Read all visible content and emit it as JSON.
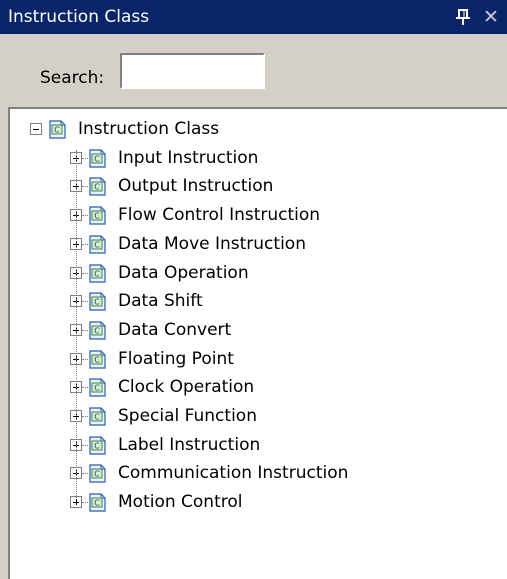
{
  "panel": {
    "title": "Instruction Class",
    "pin_icon": "pin-icon",
    "close_icon": "close-icon"
  },
  "search": {
    "label": "Search:",
    "value": "",
    "placeholder": ""
  },
  "tree": {
    "root": {
      "label": "Instruction Class",
      "expanded": true,
      "icon": "class-icon"
    },
    "children": [
      {
        "label": "Input Instruction",
        "expanded": false
      },
      {
        "label": "Output Instruction",
        "expanded": false
      },
      {
        "label": "Flow Control Instruction",
        "expanded": false
      },
      {
        "label": "Data Move Instruction",
        "expanded": false
      },
      {
        "label": "Data Operation",
        "expanded": false
      },
      {
        "label": "Data Shift",
        "expanded": false
      },
      {
        "label": "Data Convert",
        "expanded": false
      },
      {
        "label": "Floating Point",
        "expanded": false
      },
      {
        "label": "Clock Operation",
        "expanded": false
      },
      {
        "label": "Special Function",
        "expanded": false
      },
      {
        "label": "Label Instruction",
        "expanded": false
      },
      {
        "label": "Communication Instruction",
        "expanded": false
      },
      {
        "label": "Motion Control",
        "expanded": false
      }
    ]
  }
}
